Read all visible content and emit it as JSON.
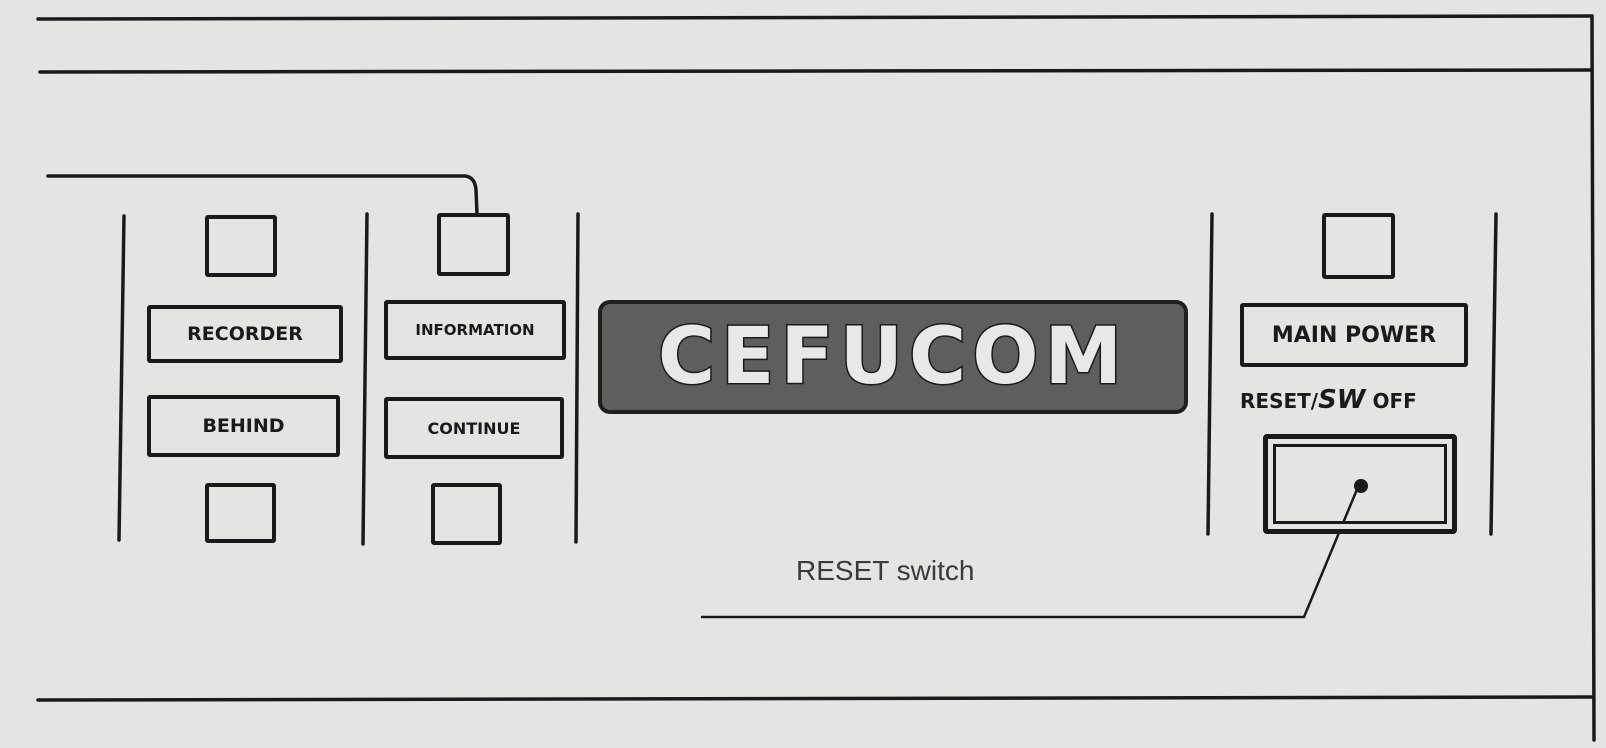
{
  "panel": {
    "logo_text": "CEFUCOM",
    "buttons": {
      "recorder": "RECORDER",
      "behind": "BEHIND",
      "information": "INFORMATION",
      "continue": "CONTINUE",
      "main_power": "MAIN POWER"
    },
    "reset_label": {
      "prefix": "RESET/",
      "sw": "SW",
      "suffix": " OFF"
    }
  },
  "annotation": {
    "reset_switch": "RESET switch"
  }
}
